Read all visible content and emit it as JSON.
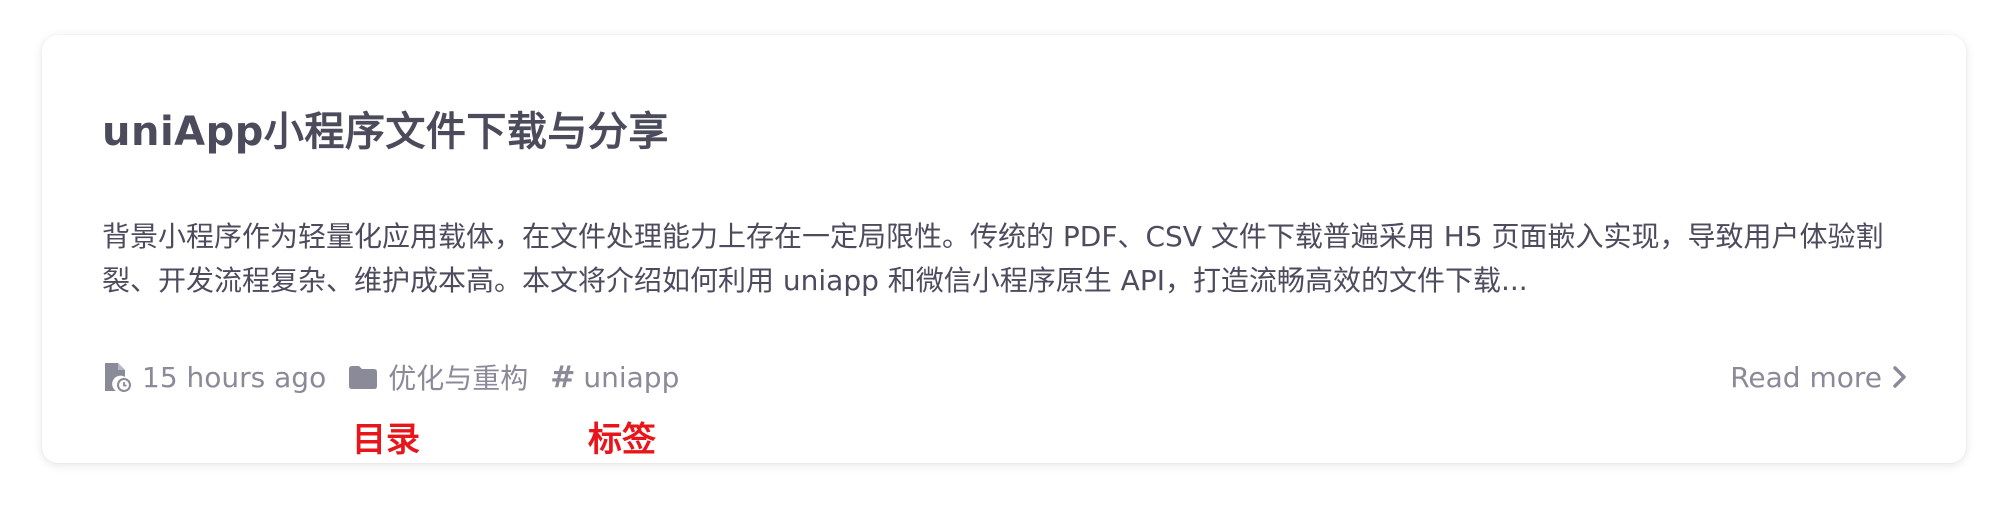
{
  "post": {
    "title": "uniApp小程序文件下载与分享",
    "excerpt": "背景小程序作为轻量化应用载体，在文件处理能力上存在一定局限性。传统的 PDF、CSV 文件下载普遍采用 H5 页面嵌入实现，导致用户体验割裂、开发流程复杂、维护成本高。本文将介绍如何利用 uniapp 和微信小程序原生 API，打造流畅高效的文件下载...",
    "meta": {
      "time": "15 hours ago",
      "category": "优化与重构",
      "tag": "uniapp"
    },
    "read_more": "Read more"
  },
  "annotations": {
    "category_label": "目录",
    "tag_label": "标签"
  },
  "icons": {
    "time": "file-clock-icon",
    "category": "folder-icon",
    "tag": "hashtag-icon",
    "read_more": "chevron-right-icon"
  },
  "colors": {
    "title": "#4b4b5c",
    "meta": "#8a8a98",
    "annotation": "#e8151b"
  }
}
